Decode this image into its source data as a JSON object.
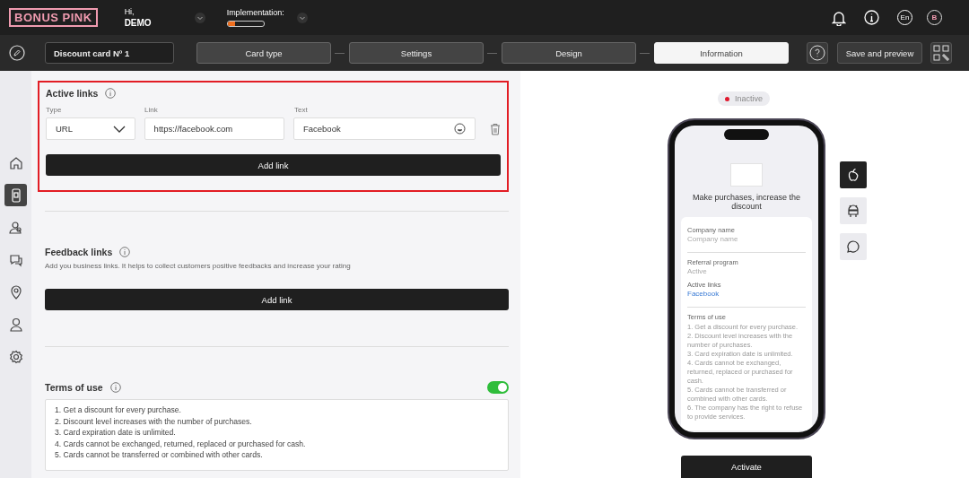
{
  "header": {
    "logo": "BONUS PINK",
    "greeting": "Hi,",
    "user": "DEMO",
    "implementation": {
      "label": "Implementation:",
      "level": 0.2
    },
    "language": "En",
    "avatar": "B"
  },
  "toolbar": {
    "card_name": "Discount card Nº 1",
    "steps": [
      {
        "label": "Card type",
        "selected": false
      },
      {
        "label": "Settings",
        "selected": false
      },
      {
        "label": "Design",
        "selected": false
      },
      {
        "label": "Information",
        "selected": true
      }
    ],
    "save_button": "Save and preview"
  },
  "sidebar": {
    "items": [
      {
        "kind": "home",
        "selected": false
      },
      {
        "kind": "card",
        "selected": true
      },
      {
        "kind": "users",
        "selected": false
      },
      {
        "kind": "chat",
        "selected": false
      },
      {
        "kind": "pin",
        "selected": false
      },
      {
        "kind": "user",
        "selected": false
      },
      {
        "kind": "settings",
        "selected": false
      }
    ]
  },
  "active_links": {
    "title": "Active links",
    "columns": [
      "Type",
      "Link",
      "Text"
    ],
    "rows": [
      {
        "type": "URL",
        "link": "https://facebook.com",
        "text": "Facebook"
      }
    ],
    "add_button": "Add link"
  },
  "feedback_links": {
    "title": "Feedback links",
    "description": "Add you business links. It helps to collect customers positive feedbacks and increase your rating",
    "add_button": "Add link"
  },
  "terms": {
    "title": "Terms of use",
    "on": true,
    "lines": [
      "1. Get a discount for every purchase.",
      "2. Discount level increases with the number of purchases.",
      "3. Card expiration date is unlimited.",
      "4. Cards cannot be exchanged, returned, replaced or purchased for cash.",
      "5. Cards cannot be transferred or combined with other cards."
    ]
  },
  "preview": {
    "status": {
      "label": "Inactive",
      "color": "#e0182d"
    },
    "platforms": [
      {
        "kind": "apple",
        "selected": true
      },
      {
        "kind": "android",
        "selected": false
      },
      {
        "kind": "chat",
        "selected": false
      }
    ],
    "phone": {
      "title": "Make purchases, increase the discount",
      "fields": [
        {
          "label": "Company name",
          "value": "Company name",
          "kind": "text"
        },
        {
          "label": "Referral program",
          "value": "Active",
          "kind": "text"
        },
        {
          "label": "Active links",
          "value": "Facebook",
          "kind": "link"
        }
      ],
      "terms_label": "Terms of use",
      "terms": [
        "1. Get a discount for every purchase.",
        "2. Discount level increases with the number of purchases.",
        "3. Card expiration date is unlimited.",
        "4. Cards cannot be exchanged, returned, replaced or purchased for cash.",
        "5. Cards cannot be transferred or combined with other cards.",
        "6. The company has the right to refuse to provide services."
      ]
    },
    "activate_button": "Activate"
  }
}
